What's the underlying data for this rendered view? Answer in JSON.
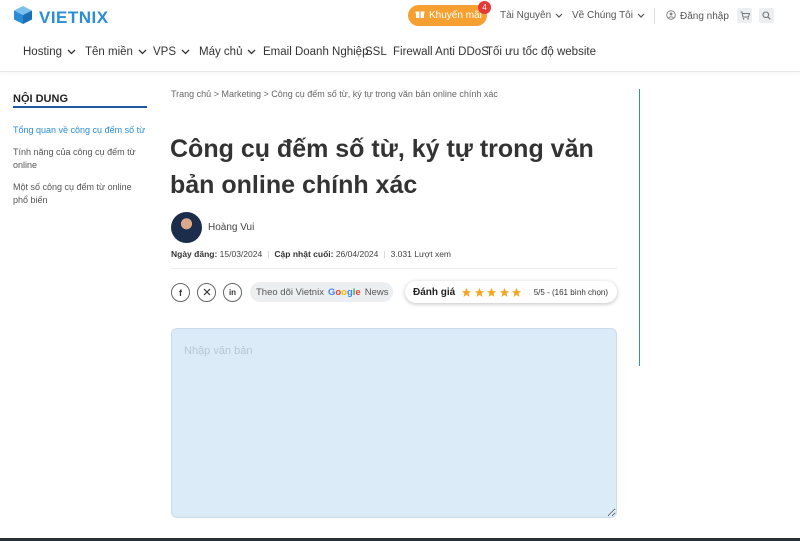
{
  "brand": {
    "name": "VIETNIX",
    "accent": "#2a8dd6",
    "promo_color": "#f5a030"
  },
  "topbar": {
    "promo_label": "Khuyến mãi",
    "promo_badge": "4",
    "resources_label": "Tài Nguyên",
    "about_label": "Về Chúng Tôi",
    "login_label": "Đăng nhập",
    "cart_icon": "cart-icon",
    "search_icon": "search-icon"
  },
  "nav": {
    "items": [
      {
        "label": "Hosting",
        "dropdown": true
      },
      {
        "label": "Tên miền",
        "dropdown": true
      },
      {
        "label": "VPS",
        "dropdown": true
      },
      {
        "label": "Máy chủ",
        "dropdown": true
      },
      {
        "label": "Email Doanh Nghiệp",
        "dropdown": false
      },
      {
        "label": "SSL",
        "dropdown": false
      },
      {
        "label": "Firewall Anti DDoS",
        "dropdown": false
      },
      {
        "label": "Tối ưu tốc độ website",
        "dropdown": false
      }
    ]
  },
  "toc": {
    "title": "NỘI DUNG",
    "items": [
      {
        "label": "Tổng quan về công cụ đếm số từ",
        "active": true
      },
      {
        "label": "Tính năng của công cụ đếm từ online",
        "active": false
      },
      {
        "label": "Một số công cụ đếm từ online phổ biến",
        "active": false
      }
    ]
  },
  "article": {
    "breadcrumb": "Trang chủ > Marketing > Công cụ đếm số từ, ký tự trong văn bản online chính xác",
    "title": "Công cụ đếm số từ, ký tự trong văn bản online chính xác",
    "author": "Hoàng Vui",
    "published_label": "Ngày đăng:",
    "published_date": "15/03/2024",
    "updated_label": "Cập nhật cuối:",
    "updated_date": "26/04/2024",
    "views": "3.031 Lượt xem"
  },
  "share": {
    "icons": [
      "facebook-icon",
      "x-icon",
      "linkedin-icon"
    ],
    "follow_label": "Theo dõi Vietnix",
    "google_letters": [
      "G",
      "o",
      "o",
      "g",
      "l",
      "e"
    ],
    "news_label": "News"
  },
  "rating": {
    "label": "Đánh giá",
    "stars": 5,
    "summary": "5/5 - (161 bình chọn)",
    "star_color": "#f5a623"
  },
  "editor": {
    "placeholder": "Nhập văn bản"
  }
}
